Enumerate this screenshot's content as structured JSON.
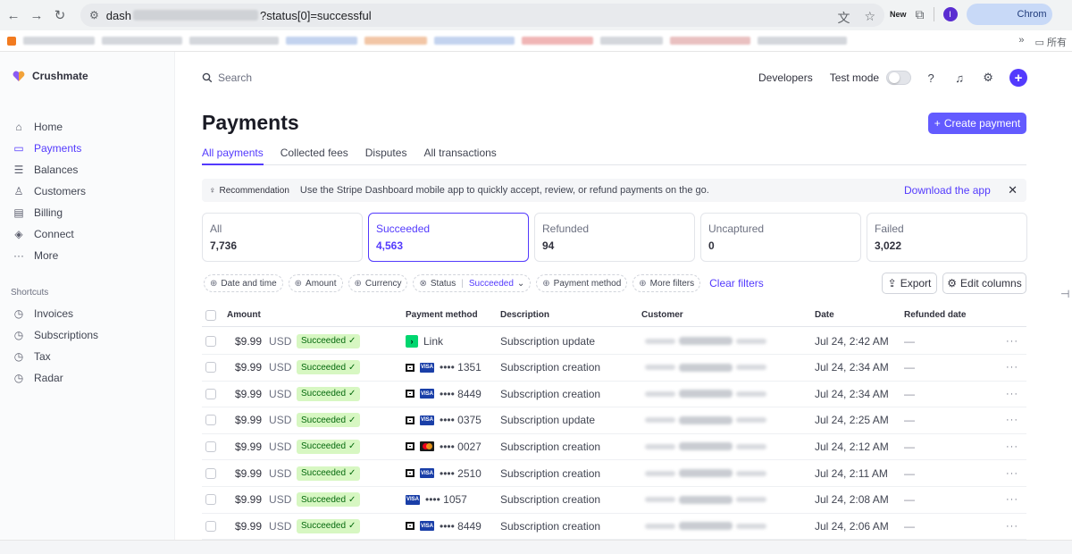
{
  "browser": {
    "url_prefix": "dash",
    "url_suffix": "?status[0]=successful",
    "profile_initial": "I",
    "chrome_label": "Chrom",
    "ext_new": "New",
    "bookmarks_more": "»",
    "bookmarks_folder": "所有"
  },
  "brand": {
    "name": "Crushmate"
  },
  "sidebar": {
    "items": [
      {
        "label": "Home",
        "icon": "home-icon",
        "glyph": "⌂"
      },
      {
        "label": "Payments",
        "icon": "payments-icon",
        "glyph": "▭"
      },
      {
        "label": "Balances",
        "icon": "balances-icon",
        "glyph": "☰"
      },
      {
        "label": "Customers",
        "icon": "customers-icon",
        "glyph": "♙"
      },
      {
        "label": "Billing",
        "icon": "billing-icon",
        "glyph": "▤"
      },
      {
        "label": "Connect",
        "icon": "connect-icon",
        "glyph": "◈"
      },
      {
        "label": "More",
        "icon": "more-icon",
        "glyph": "···"
      }
    ],
    "shortcuts_title": "Shortcuts",
    "shortcuts": [
      {
        "label": "Invoices",
        "icon": "clock-icon",
        "glyph": "◷"
      },
      {
        "label": "Subscriptions",
        "icon": "clock-icon",
        "glyph": "◷"
      },
      {
        "label": "Tax",
        "icon": "clock-icon",
        "glyph": "◷"
      },
      {
        "label": "Radar",
        "icon": "clock-icon",
        "glyph": "◷"
      }
    ]
  },
  "topbar": {
    "search_placeholder": "Search",
    "developers": "Developers",
    "test_mode": "Test mode"
  },
  "page": {
    "title": "Payments",
    "create_button": "Create payment",
    "tabs": [
      "All payments",
      "Collected fees",
      "Disputes",
      "All transactions"
    ]
  },
  "recommendation": {
    "tag": "Recommendation",
    "text": "Use the Stripe Dashboard mobile app to quickly accept, review, or refund payments on the go.",
    "link": "Download the app"
  },
  "summary_cards": [
    {
      "label": "All",
      "count": "7,736"
    },
    {
      "label": "Succeeded",
      "count": "4,563"
    },
    {
      "label": "Refunded",
      "count": "94"
    },
    {
      "label": "Uncaptured",
      "count": "0"
    },
    {
      "label": "Failed",
      "count": "3,022"
    }
  ],
  "filters": {
    "date": "Date and time",
    "amount": "Amount",
    "currency": "Currency",
    "status": "Status",
    "status_value": "Succeeded",
    "payment_method": "Payment method",
    "more": "More filters",
    "clear": "Clear filters",
    "export": "Export",
    "edit_columns": "Edit columns"
  },
  "table": {
    "headers": {
      "amount": "Amount",
      "payment_method": "Payment method",
      "description": "Description",
      "customer": "Customer",
      "date": "Date",
      "refunded_date": "Refunded date"
    },
    "rows": [
      {
        "amount": "$9.99",
        "currency": "USD",
        "status": "Succeeded",
        "method": "link",
        "method_text": "Link",
        "description": "Subscription update",
        "date": "Jul 24, 2:42 AM",
        "refunded": "—"
      },
      {
        "amount": "$9.99",
        "currency": "USD",
        "status": "Succeeded",
        "method": "visa",
        "method_text": "•••• 1351",
        "description": "Subscription creation",
        "date": "Jul 24, 2:34 AM",
        "refunded": "—"
      },
      {
        "amount": "$9.99",
        "currency": "USD",
        "status": "Succeeded",
        "method": "visa",
        "method_text": "•••• 8449",
        "description": "Subscription creation",
        "date": "Jul 24, 2:34 AM",
        "refunded": "—"
      },
      {
        "amount": "$9.99",
        "currency": "USD",
        "status": "Succeeded",
        "method": "visa",
        "method_text": "•••• 0375",
        "description": "Subscription update",
        "date": "Jul 24, 2:25 AM",
        "refunded": "—"
      },
      {
        "amount": "$9.99",
        "currency": "USD",
        "status": "Succeeded",
        "method": "mastercard",
        "method_text": "•••• 0027",
        "description": "Subscription creation",
        "date": "Jul 24, 2:12 AM",
        "refunded": "—"
      },
      {
        "amount": "$9.99",
        "currency": "USD",
        "status": "Succeeded",
        "method": "visa",
        "method_text": "•••• 2510",
        "description": "Subscription creation",
        "date": "Jul 24, 2:11 AM",
        "refunded": "—"
      },
      {
        "amount": "$9.99",
        "currency": "USD",
        "status": "Succeeded",
        "method": "visa-only",
        "method_text": "•••• 1057",
        "description": "Subscription creation",
        "date": "Jul 24, 2:08 AM",
        "refunded": "—"
      },
      {
        "amount": "$9.99",
        "currency": "USD",
        "status": "Succeeded",
        "method": "visa",
        "method_text": "•••• 8449",
        "description": "Subscription creation",
        "date": "Jul 24, 2:06 AM",
        "refunded": "—"
      }
    ]
  },
  "colors": {
    "accent": "#533afd",
    "success_bg": "#d7f7c2",
    "success_fg": "#05690d"
  }
}
